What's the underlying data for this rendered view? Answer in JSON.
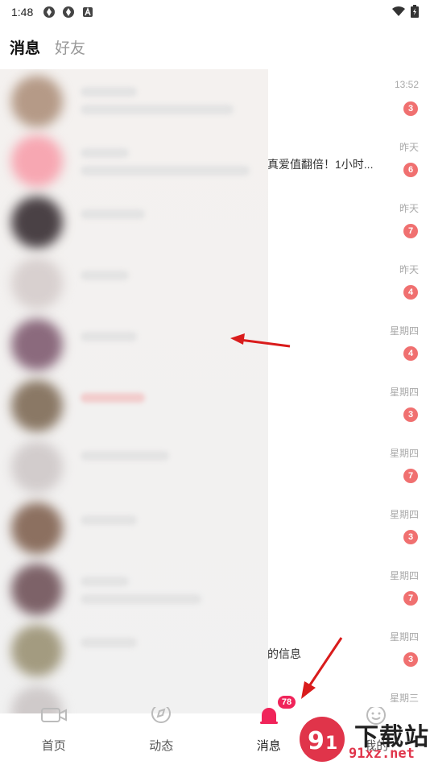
{
  "status_bar": {
    "time": "1:48"
  },
  "tabs": [
    {
      "label": "消息",
      "active": true
    },
    {
      "label": "好友",
      "active": false
    }
  ],
  "conversations": [
    {
      "time": "13:52",
      "unread": "3",
      "snippet": ""
    },
    {
      "time": "昨天",
      "unread": "6",
      "snippet": "真爱值翻倍！1小时..."
    },
    {
      "time": "昨天",
      "unread": "7",
      "snippet": ""
    },
    {
      "time": "昨天",
      "unread": "4",
      "snippet": ""
    },
    {
      "time": "星期四",
      "unread": "4",
      "snippet": ""
    },
    {
      "time": "星期四",
      "unread": "3",
      "snippet": ""
    },
    {
      "time": "星期四",
      "unread": "7",
      "snippet": ""
    },
    {
      "time": "星期四",
      "unread": "3",
      "snippet": ""
    },
    {
      "time": "星期四",
      "unread": "7",
      "snippet": ""
    },
    {
      "time": "星期四",
      "unread": "3",
      "snippet": "的信息"
    },
    {
      "time": "星期三",
      "unread": "",
      "snippet": ""
    }
  ],
  "bottom_nav": [
    {
      "label": "首页",
      "icon": "camera-icon"
    },
    {
      "label": "动态",
      "icon": "compass-icon"
    },
    {
      "label": "消息",
      "icon": "bell-icon",
      "badge": "78",
      "active": true
    },
    {
      "label": "我的",
      "icon": "face-icon"
    }
  ],
  "watermark": {
    "text": "下载站",
    "url": "91xz.net"
  },
  "colors": {
    "badge": "#f07070",
    "accent": "#f0245a",
    "arrow": "#d91c1c"
  }
}
